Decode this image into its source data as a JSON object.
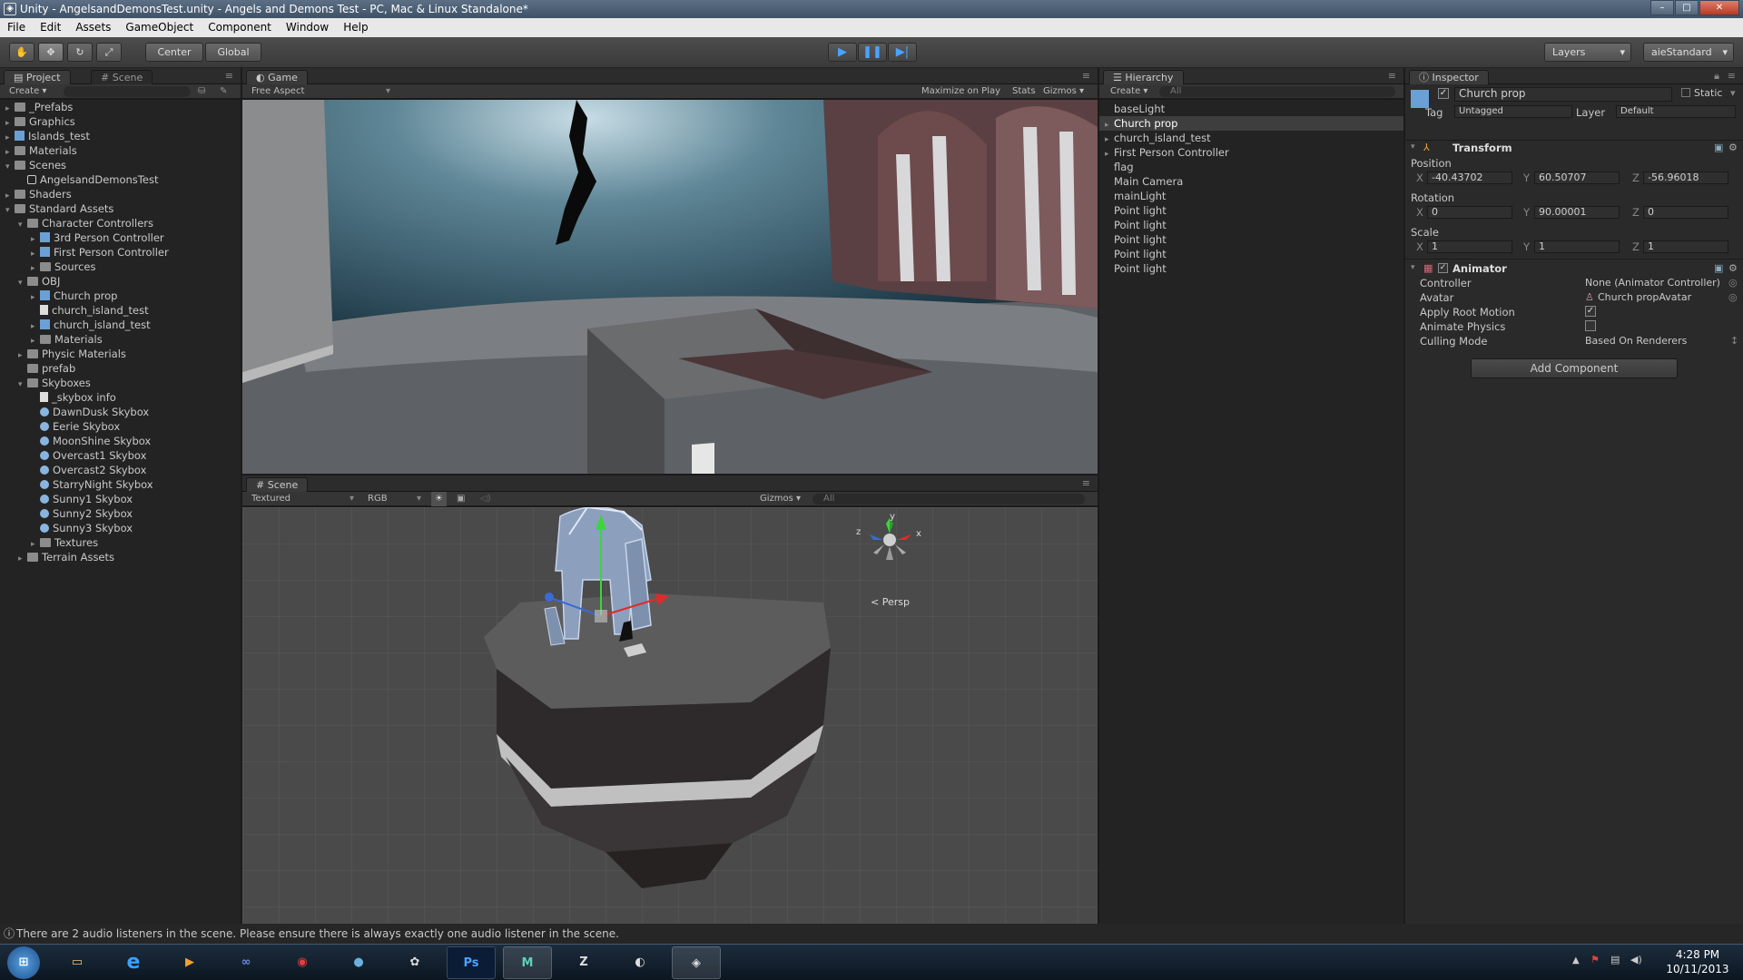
{
  "window": {
    "title": "Unity - AngelsandDemonsTest.unity - Angels and Demons Test - PC, Mac & Linux Standalone*"
  },
  "menu": [
    "File",
    "Edit",
    "Assets",
    "GameObject",
    "Component",
    "Window",
    "Help"
  ],
  "toolbar": {
    "center": "Center",
    "global": "Global",
    "layers": "Layers",
    "layout": "aieStandard"
  },
  "project": {
    "tab": "Project",
    "scene_tab": "Scene",
    "create": "Create",
    "items": [
      {
        "label": "_Prefabs",
        "depth": 0,
        "arrow": "▸",
        "icon": "folder"
      },
      {
        "label": "Graphics",
        "depth": 0,
        "arrow": "▸",
        "icon": "folder"
      },
      {
        "label": "Islands_test",
        "depth": 0,
        "arrow": "▸",
        "icon": "cube"
      },
      {
        "label": "Materials",
        "depth": 0,
        "arrow": "▸",
        "icon": "folder"
      },
      {
        "label": "Scenes",
        "depth": 0,
        "arrow": "▾",
        "icon": "folder"
      },
      {
        "label": "AngelsandDemonsTest",
        "depth": 1,
        "arrow": "",
        "icon": "scene"
      },
      {
        "label": "Shaders",
        "depth": 0,
        "arrow": "▸",
        "icon": "folder"
      },
      {
        "label": "Standard Assets",
        "depth": 0,
        "arrow": "▾",
        "icon": "folder"
      },
      {
        "label": "Character Controllers",
        "depth": 1,
        "arrow": "▾",
        "icon": "folder"
      },
      {
        "label": "3rd Person Controller",
        "depth": 2,
        "arrow": "▸",
        "icon": "cube"
      },
      {
        "label": "First Person Controller",
        "depth": 2,
        "arrow": "▸",
        "icon": "cube"
      },
      {
        "label": "Sources",
        "depth": 2,
        "arrow": "▸",
        "icon": "folder"
      },
      {
        "label": "OBJ",
        "depth": 1,
        "arrow": "▾",
        "icon": "folder"
      },
      {
        "label": "Church prop",
        "depth": 2,
        "arrow": "▸",
        "icon": "cube"
      },
      {
        "label": "church_island_test",
        "depth": 2,
        "arrow": "",
        "icon": "page"
      },
      {
        "label": "church_island_test",
        "depth": 2,
        "arrow": "▸",
        "icon": "cube"
      },
      {
        "label": "Materials",
        "depth": 2,
        "arrow": "▸",
        "icon": "folder"
      },
      {
        "label": "Physic Materials",
        "depth": 1,
        "arrow": "▸",
        "icon": "folder"
      },
      {
        "label": "prefab",
        "depth": 1,
        "arrow": "",
        "icon": "folder"
      },
      {
        "label": "Skyboxes",
        "depth": 1,
        "arrow": "▾",
        "icon": "folder"
      },
      {
        "label": "_skybox info",
        "depth": 2,
        "arrow": "",
        "icon": "page"
      },
      {
        "label": "DawnDusk Skybox",
        "depth": 2,
        "arrow": "",
        "icon": "sphere"
      },
      {
        "label": "Eerie Skybox",
        "depth": 2,
        "arrow": "",
        "icon": "sphere"
      },
      {
        "label": "MoonShine Skybox",
        "depth": 2,
        "arrow": "",
        "icon": "sphere"
      },
      {
        "label": "Overcast1 Skybox",
        "depth": 2,
        "arrow": "",
        "icon": "sphere"
      },
      {
        "label": "Overcast2 Skybox",
        "depth": 2,
        "arrow": "",
        "icon": "sphere"
      },
      {
        "label": "StarryNight Skybox",
        "depth": 2,
        "arrow": "",
        "icon": "sphere"
      },
      {
        "label": "Sunny1 Skybox",
        "depth": 2,
        "arrow": "",
        "icon": "sphere"
      },
      {
        "label": "Sunny2 Skybox",
        "depth": 2,
        "arrow": "",
        "icon": "sphere"
      },
      {
        "label": "Sunny3 Skybox",
        "depth": 2,
        "arrow": "",
        "icon": "sphere"
      },
      {
        "label": "Textures",
        "depth": 2,
        "arrow": "▸",
        "icon": "folder"
      },
      {
        "label": "Terrain Assets",
        "depth": 1,
        "arrow": "▸",
        "icon": "folder"
      }
    ]
  },
  "game": {
    "tab": "Game",
    "aspect": "Free Aspect",
    "maximize": "Maximize on Play",
    "stats": "Stats",
    "gizmos": "Gizmos"
  },
  "scene": {
    "tab": "Scene",
    "shading": "Textured",
    "rgb": "RGB",
    "gizmos": "Gizmos",
    "search": "All",
    "persp": "Persp",
    "axis_x": "x",
    "axis_y": "y",
    "axis_z": "z"
  },
  "hierarchy": {
    "tab": "Hierarchy",
    "create": "Create",
    "search": "All",
    "items": [
      {
        "label": "baseLight",
        "arrow": ""
      },
      {
        "label": "Church prop",
        "arrow": "▸",
        "selected": true
      },
      {
        "label": "church_island_test",
        "arrow": "▸"
      },
      {
        "label": "First Person Controller",
        "arrow": "▸"
      },
      {
        "label": "flag",
        "arrow": ""
      },
      {
        "label": "Main Camera",
        "arrow": ""
      },
      {
        "label": "mainLight",
        "arrow": ""
      },
      {
        "label": "Point light",
        "arrow": ""
      },
      {
        "label": "Point light",
        "arrow": ""
      },
      {
        "label": "Point light",
        "arrow": ""
      },
      {
        "label": "Point light",
        "arrow": ""
      },
      {
        "label": "Point light",
        "arrow": ""
      }
    ]
  },
  "inspector": {
    "tab": "Inspector",
    "name": "Church prop",
    "static": "Static",
    "tag_label": "Tag",
    "tag": "Untagged",
    "layer_label": "Layer",
    "layer": "Default",
    "transform": {
      "title": "Transform",
      "position": "Position",
      "rotation": "Rotation",
      "scale": "Scale",
      "pos": [
        "-40.43702",
        "60.50707",
        "-56.96018"
      ],
      "rot": [
        "0",
        "90.00001",
        "0"
      ],
      "scl": [
        "1",
        "1",
        "1"
      ],
      "axes": [
        "X",
        "Y",
        "Z"
      ]
    },
    "animator": {
      "title": "Animator",
      "controller_label": "Controller",
      "controller": "None (Animator Controller)",
      "avatar_label": "Avatar",
      "avatar": "Church propAvatar",
      "root_motion": "Apply Root Motion",
      "physics": "Animate Physics",
      "culling_label": "Culling Mode",
      "culling": "Based On Renderers"
    },
    "add_component": "Add Component"
  },
  "status": {
    "message": "There are 2 audio listeners in the scene. Please ensure there is always exactly one audio listener in the scene."
  },
  "taskbar": {
    "time": "4:28 PM",
    "date": "10/11/2013",
    "ps": "Ps"
  }
}
